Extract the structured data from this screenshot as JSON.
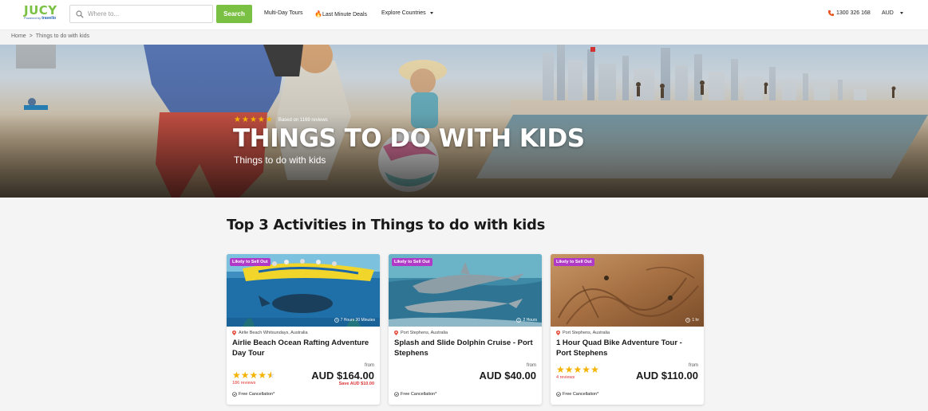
{
  "header": {
    "logo_text": "JUCY",
    "logo_sub": "Powered by",
    "logo_brand": "travello",
    "search_placeholder": "Where to...",
    "search_button": "Search",
    "nav": [
      {
        "label": "Multi-Day Tours"
      },
      {
        "label": "Last Minute Deals",
        "icon": "fire-icon"
      },
      {
        "label": "Explore Countries",
        "has_dropdown": true
      }
    ],
    "phone": "1300 326 168",
    "currency": "AUD"
  },
  "breadcrumb": {
    "home": "Home",
    "separator": ">",
    "current": "Things to do with kids"
  },
  "hero": {
    "rating_stars": 5,
    "based_on": "Based on 1169 reviews",
    "title": "THINGS TO DO WITH KIDS",
    "subtitle": "Things to do with kids"
  },
  "section": {
    "title": "Top 3 Activities in Things to do with kids"
  },
  "cards": [
    {
      "badge": "Likely to Sell Out",
      "duration": "7 Hours 30 Minutes",
      "location": "Airlie Beach Whitsundays, Australia",
      "title": "Airlie Beach Ocean Rafting Adventure Day Tour",
      "from": "from",
      "price": "AUD $164.00",
      "save": "Save AUD $10.00",
      "rating": 4.5,
      "reviews": "186 reviews",
      "free_cancellation": "Free Cancellation*"
    },
    {
      "badge": "Likely to Sell Out",
      "duration": "2 Hours",
      "location": "Port Stephens, Australia",
      "title": "Splash and Slide Dolphin Cruise - Port Stephens",
      "from": "from",
      "price": "AUD $40.00",
      "free_cancellation": "Free Cancellation*"
    },
    {
      "badge": "Likely to Sell Out",
      "duration": "1 hr",
      "location": "Port Stephens, Australia",
      "title": "1 Hour Quad Bike Adventure Tour - Port Stephens",
      "from": "from",
      "price": "AUD $110.00",
      "rating": 5,
      "reviews": "4 reviews",
      "free_cancellation": "Free Cancellation*"
    }
  ],
  "colors": {
    "brand_green": "#7ac143",
    "badge_purple": "#b03ac7",
    "star": "#f5b301",
    "sale_red": "#dd3333"
  }
}
